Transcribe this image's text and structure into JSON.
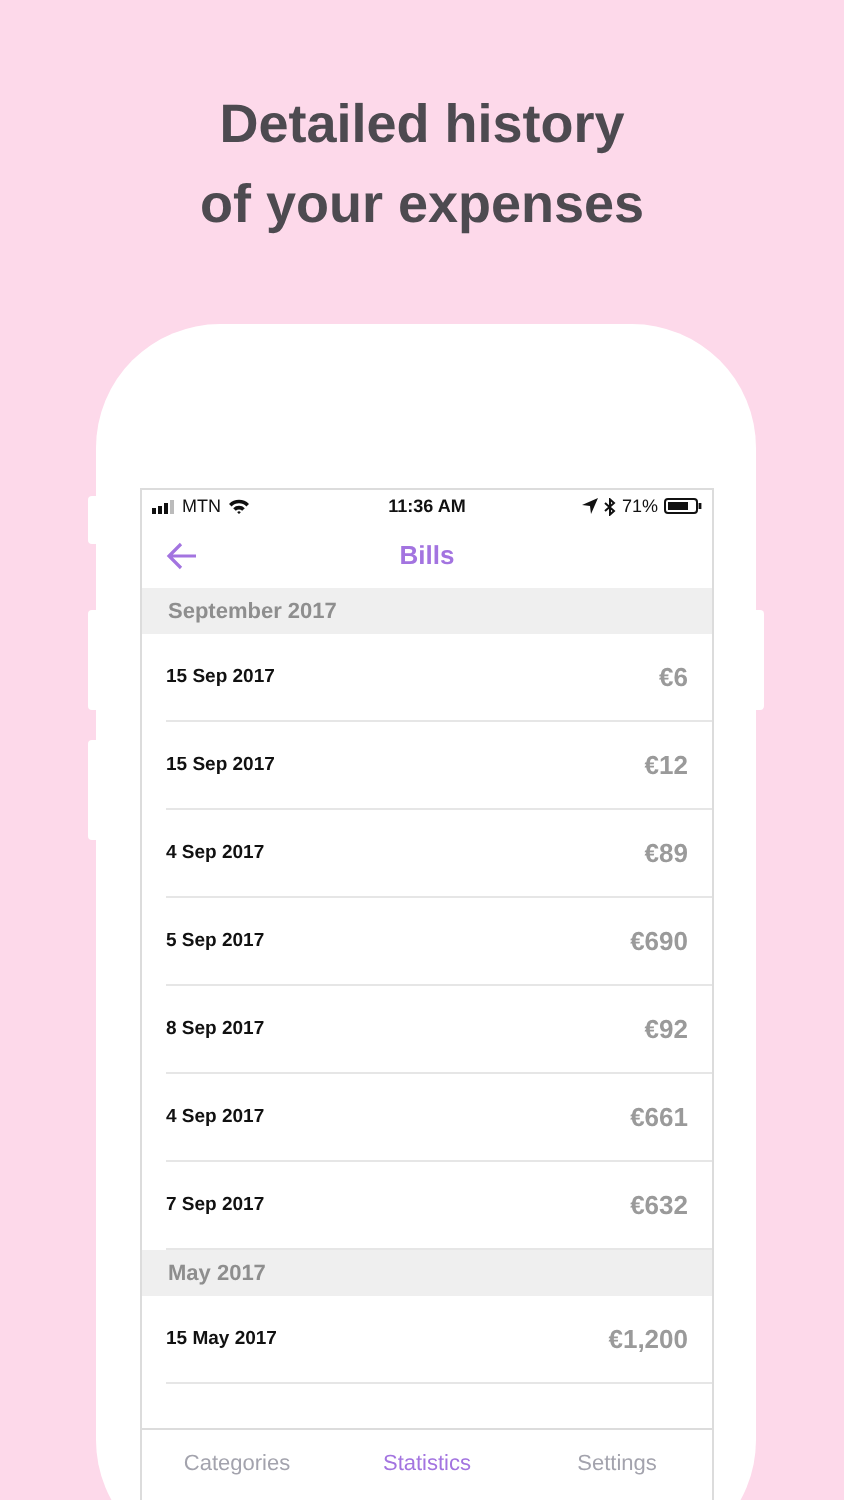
{
  "headline": "Detailed history\nof your expenses",
  "status_bar": {
    "carrier": "MTN",
    "time": "11:36 AM",
    "battery": "71%"
  },
  "nav": {
    "title": "Bills"
  },
  "sections": [
    {
      "title": "September 2017",
      "rows": [
        {
          "date": "15 Sep 2017",
          "amount": "€6"
        },
        {
          "date": "15 Sep 2017",
          "amount": "€12"
        },
        {
          "date": "4 Sep 2017",
          "amount": "€89"
        },
        {
          "date": "5 Sep 2017",
          "amount": "€690"
        },
        {
          "date": "8 Sep 2017",
          "amount": "€92"
        },
        {
          "date": "4 Sep 2017",
          "amount": "€661"
        },
        {
          "date": "7 Sep 2017",
          "amount": "€632"
        }
      ]
    },
    {
      "title": "May 2017",
      "rows": [
        {
          "date": "15 May 2017",
          "amount": "€1,200"
        }
      ]
    }
  ],
  "tabs": [
    {
      "label": "Categories",
      "selected": false
    },
    {
      "label": "Statistics",
      "selected": true
    },
    {
      "label": "Settings",
      "selected": false
    }
  ]
}
